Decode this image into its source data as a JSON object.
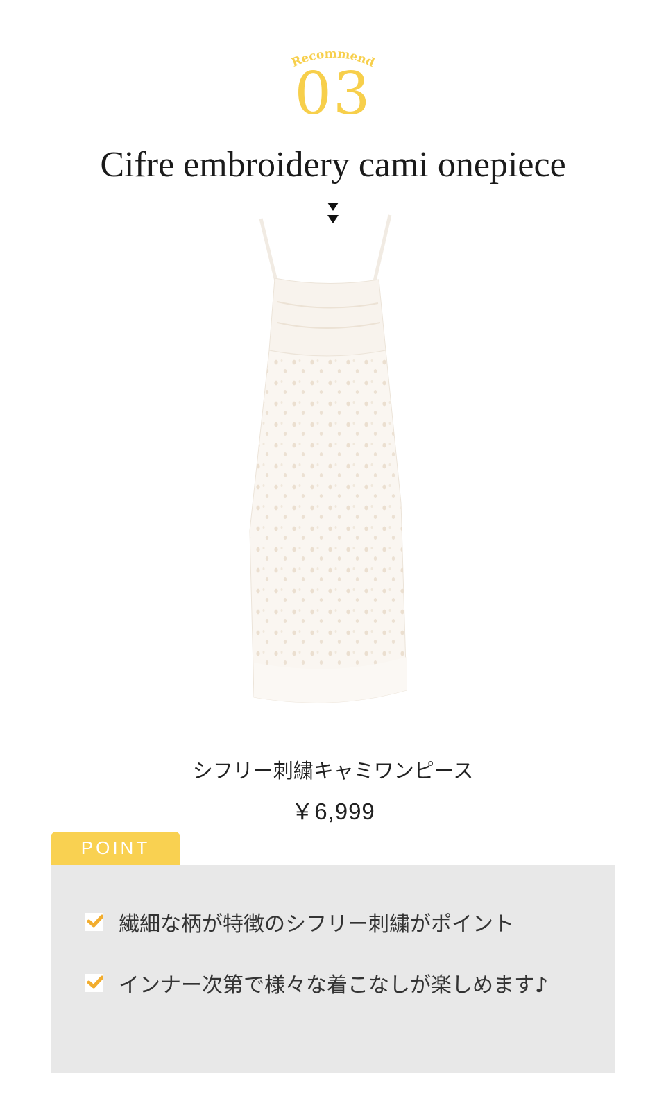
{
  "header": {
    "label": "Recommend",
    "number": "03",
    "title": "Cifre embroidery cami onepiece"
  },
  "product": {
    "image_icon": "white-eyelet-cami-dress-photo",
    "name": "シフリー刺繍キャミワンピース",
    "price": "￥6,999"
  },
  "point": {
    "tab_label": "POINT",
    "items": [
      {
        "text": "繊細な柄が特徴のシフリー刺繍がポイント"
      },
      {
        "text": "インナー次第で様々な着こなしが楽しめます♪"
      }
    ]
  },
  "colors": {
    "accent_yellow": "#f9d151",
    "check_orange": "#f2ad2e",
    "point_background": "#e8e8e8"
  }
}
